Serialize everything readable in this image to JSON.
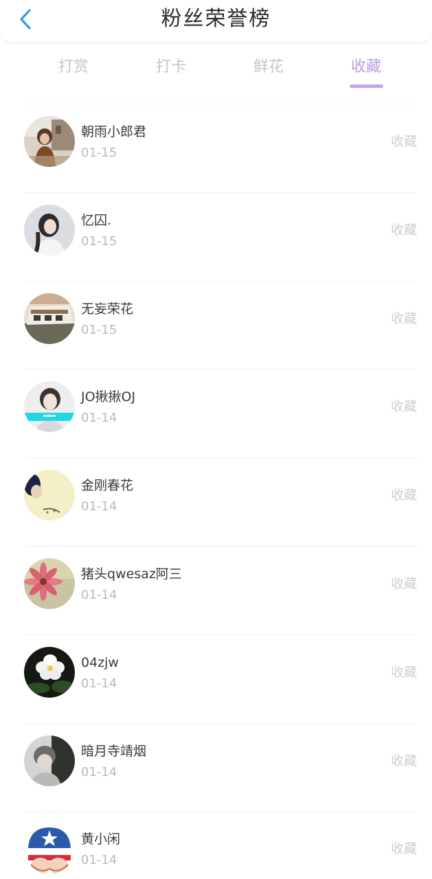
{
  "header": {
    "title": "粉丝荣誉榜",
    "back_icon": "chevron-left-icon",
    "accent_color": "#2e9bf0"
  },
  "tabs": [
    {
      "label": "打赏",
      "active": false
    },
    {
      "label": "打卡",
      "active": false
    },
    {
      "label": "鲜花",
      "active": false
    },
    {
      "label": "收藏",
      "active": true
    }
  ],
  "colors": {
    "active_tab": "#b99ee0",
    "indicator": "#c3a4ea",
    "inactive_tab": "#c6c6c6",
    "date": "#b9b9b9",
    "action": "#cfcfcf"
  },
  "fans": [
    {
      "name": "朝雨小郎君",
      "date": "01-15",
      "action": "收藏",
      "avatar": "avatar-photo"
    },
    {
      "name": "忆囚.",
      "date": "01-15",
      "action": "收藏",
      "avatar": "avatar-photo"
    },
    {
      "name": "无妄荣花",
      "date": "01-15",
      "action": "收藏",
      "avatar": "avatar-photo"
    },
    {
      "name": "JO揪揪OJ",
      "date": "01-14",
      "action": "收藏",
      "avatar": "avatar-photo"
    },
    {
      "name": "金刚春花",
      "date": "01-14",
      "action": "收藏",
      "avatar": "avatar-photo"
    },
    {
      "name": "猪头qwesaz阿三",
      "date": "01-14",
      "action": "收藏",
      "avatar": "avatar-photo"
    },
    {
      "name": "04zjw",
      "date": "01-14",
      "action": "收藏",
      "avatar": "avatar-photo"
    },
    {
      "name": "暗月寺靖烟",
      "date": "01-14",
      "action": "收藏",
      "avatar": "avatar-photo"
    },
    {
      "name": "黄小闲",
      "date": "01-14",
      "action": "收藏",
      "avatar": "avatar-cartoon"
    }
  ]
}
